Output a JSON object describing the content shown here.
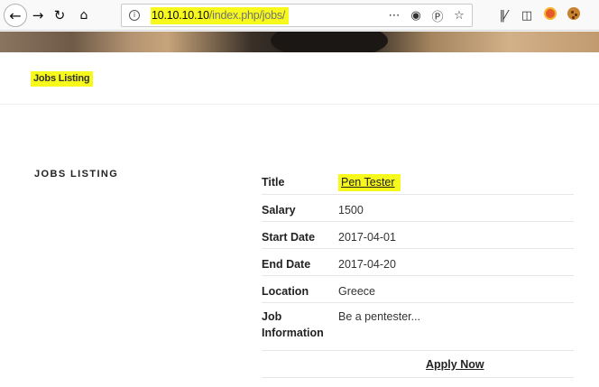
{
  "browser": {
    "url_host": "10.10.10.10",
    "url_path": "/index.php/jobs/",
    "icons": {
      "back": "back-arrow-icon",
      "forward": "forward-arrow-icon",
      "reload": "reload-icon",
      "home": "home-icon",
      "info": "info-icon",
      "more": "ellipsis-icon",
      "pocket": "pocket-icon",
      "wordpress": "wordpress-icon",
      "bookmark": "star-icon",
      "library": "library-icon",
      "sidebar": "sidebar-icon",
      "addon_red": "extension-icon",
      "cookie": "cookie-icon"
    }
  },
  "site": {
    "nav_link": "Jobs Listing",
    "highlight_color": "#f7f81c"
  },
  "main": {
    "section_heading": "Jobs Listing",
    "job": {
      "title_label": "Title",
      "title_value": "Pen Tester",
      "salary_label": "Salary",
      "salary_value": "1500",
      "start_label": "Start Date",
      "start_value": "2017-04-01",
      "end_label": "End Date",
      "end_value": "2017-04-20",
      "location_label": "Location",
      "location_value": "Greece",
      "info_label": "Job Information",
      "info_value": "Be a pentester..."
    },
    "apply_label": "Apply Now"
  }
}
